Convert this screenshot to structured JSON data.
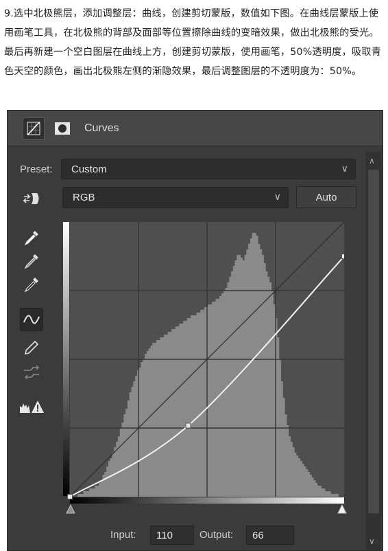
{
  "instructions": {
    "text": "9.选中北极熊层，添加调整层：曲线，创建剪切蒙版，数值如下图。在曲线层蒙版上使用画笔工具，在北极熊的背部及面部等位置擦除曲线的变暗效果，做出北极熊的受光。最后再新建一个空白图层在曲线上方，创建剪切蒙版，使用画笔，50%透明度，吸取青色天空的颜色，画出北极熊左侧的渐隐效果，最后调整图层的不透明度为：50%。"
  },
  "panel": {
    "title": "Curves",
    "preset_label": "Preset:",
    "preset_value": "Custom",
    "channel_value": "RGB",
    "auto_label": "Auto",
    "input_label": "Input:",
    "input_value": "110",
    "output_label": "Output:",
    "output_value": "66"
  },
  "curve": {
    "points": [
      [
        0,
        0
      ],
      [
        110,
        66
      ],
      [
        255,
        223
      ]
    ]
  },
  "histogram": [
    0,
    0,
    0,
    0,
    1,
    1,
    1,
    2,
    2,
    2,
    3,
    3,
    3,
    4,
    4,
    5,
    6,
    8,
    9,
    11,
    13,
    14,
    16,
    18,
    20,
    22,
    25,
    27,
    30,
    32,
    35,
    38,
    40,
    42,
    44,
    46,
    47,
    49,
    50,
    52,
    53,
    54,
    55,
    56,
    56,
    57,
    57,
    58,
    58,
    59,
    59,
    60,
    60,
    61,
    61,
    62,
    62,
    63,
    63,
    64,
    64,
    65,
    65,
    66,
    66,
    66,
    67,
    67,
    68,
    68,
    69,
    69,
    70,
    70,
    71,
    71,
    72,
    72,
    73,
    74,
    75,
    76,
    78,
    80,
    82,
    84,
    86,
    88,
    88,
    87,
    86,
    88,
    90,
    92,
    94,
    96,
    96,
    95,
    92,
    90,
    88,
    85,
    82,
    80,
    78,
    75,
    70,
    65,
    58,
    50,
    42,
    36,
    30,
    26,
    22,
    20,
    18,
    16,
    15,
    14,
    13,
    12,
    11,
    10,
    9,
    8,
    7,
    6,
    5,
    4,
    4,
    3,
    3,
    2,
    2,
    2,
    1,
    1,
    1,
    1,
    0,
    0,
    0
  ],
  "colors": {
    "panel_bg": "#3b3b3b",
    "graph_bg": "#4f4f4f",
    "histogram": "#8a8a8a",
    "curve": "#f2f2f2"
  }
}
